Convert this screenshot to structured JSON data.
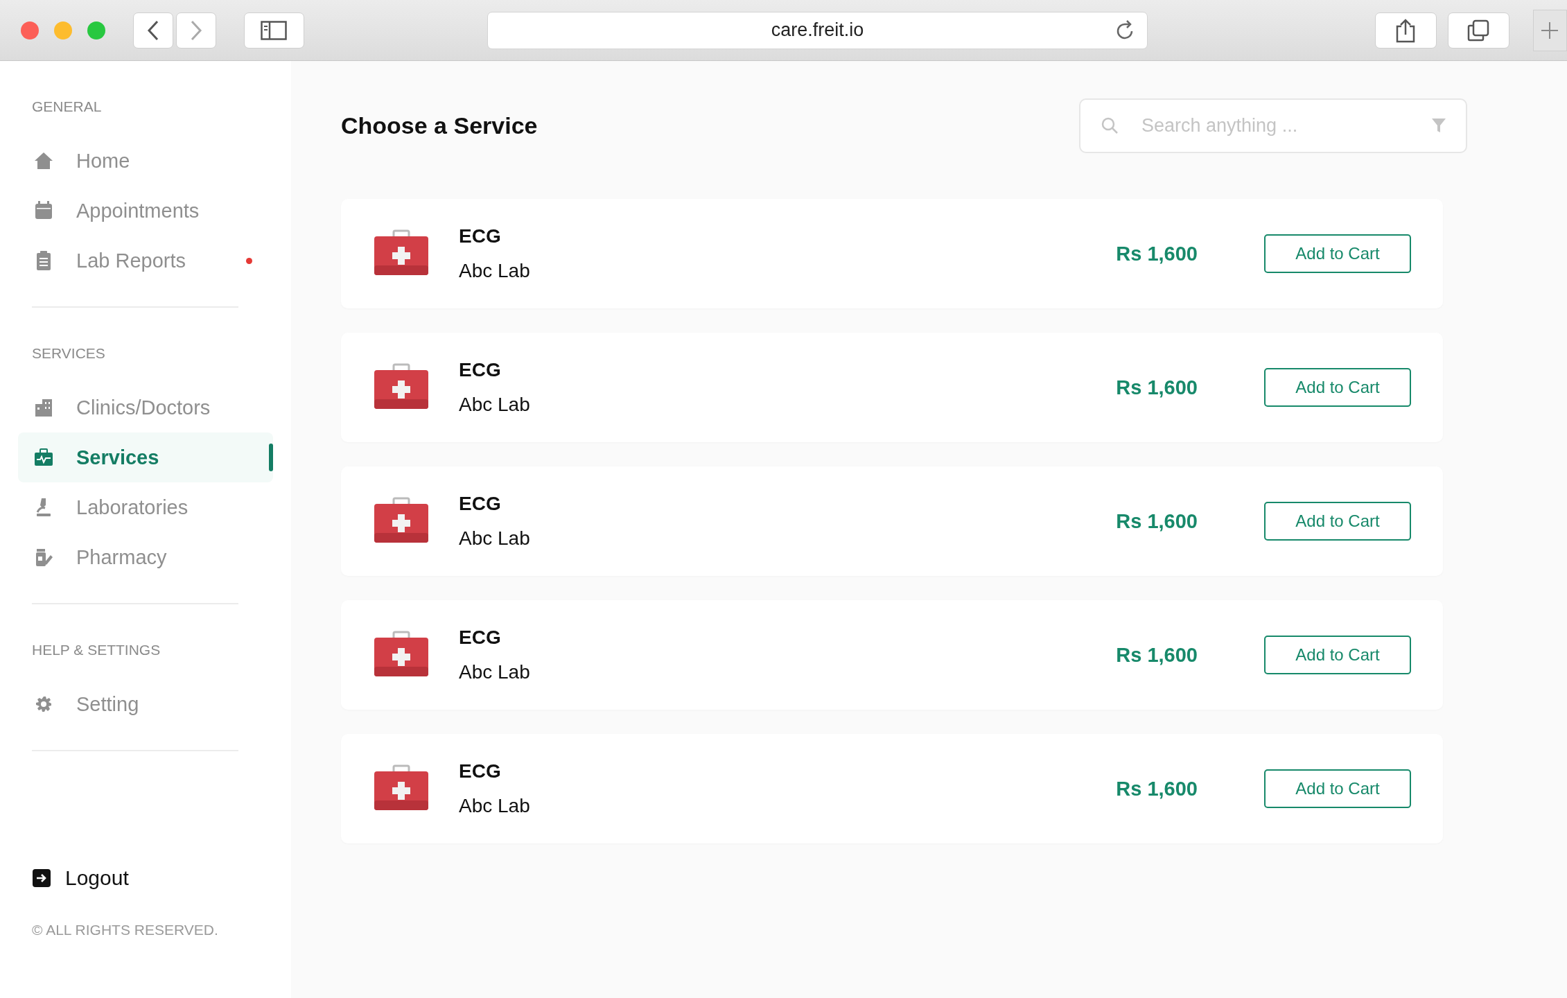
{
  "browser": {
    "url": "care.freit.io"
  },
  "sidebar": {
    "sections": [
      {
        "title": "GENERAL",
        "items": [
          {
            "label": "Home",
            "selected": false,
            "dot": false
          },
          {
            "label": "Appointments",
            "selected": false,
            "dot": false
          },
          {
            "label": "Lab Reports",
            "selected": false,
            "dot": true
          }
        ]
      },
      {
        "title": "SERVICES",
        "items": [
          {
            "label": "Clinics/Doctors",
            "selected": false,
            "dot": false
          },
          {
            "label": "Services",
            "selected": true,
            "dot": false
          },
          {
            "label": "Laboratories",
            "selected": false,
            "dot": false
          },
          {
            "label": "Pharmacy",
            "selected": false,
            "dot": false
          }
        ]
      },
      {
        "title": "HELP & SETTINGS",
        "items": [
          {
            "label": "Setting",
            "selected": false,
            "dot": false
          }
        ]
      }
    ],
    "logout": "Logout",
    "copyright": "© ALL RIGHTS RESERVED."
  },
  "main": {
    "title": "Choose a Service",
    "search": {
      "placeholder": "Search anything ..."
    },
    "services": [
      {
        "name": "ECG",
        "provider": "Abc Lab",
        "price": "Rs 1,600",
        "button": "Add to Cart"
      },
      {
        "name": "ECG",
        "provider": "Abc Lab",
        "price": "Rs 1,600",
        "button": "Add to Cart"
      },
      {
        "name": "ECG",
        "provider": "Abc Lab",
        "price": "Rs 1,600",
        "button": "Add to Cart"
      },
      {
        "name": "ECG",
        "provider": "Abc Lab",
        "price": "Rs 1,600",
        "button": "Add to Cart"
      },
      {
        "name": "ECG",
        "provider": "Abc Lab",
        "price": "Rs 1,600",
        "button": "Add to Cart"
      }
    ]
  }
}
